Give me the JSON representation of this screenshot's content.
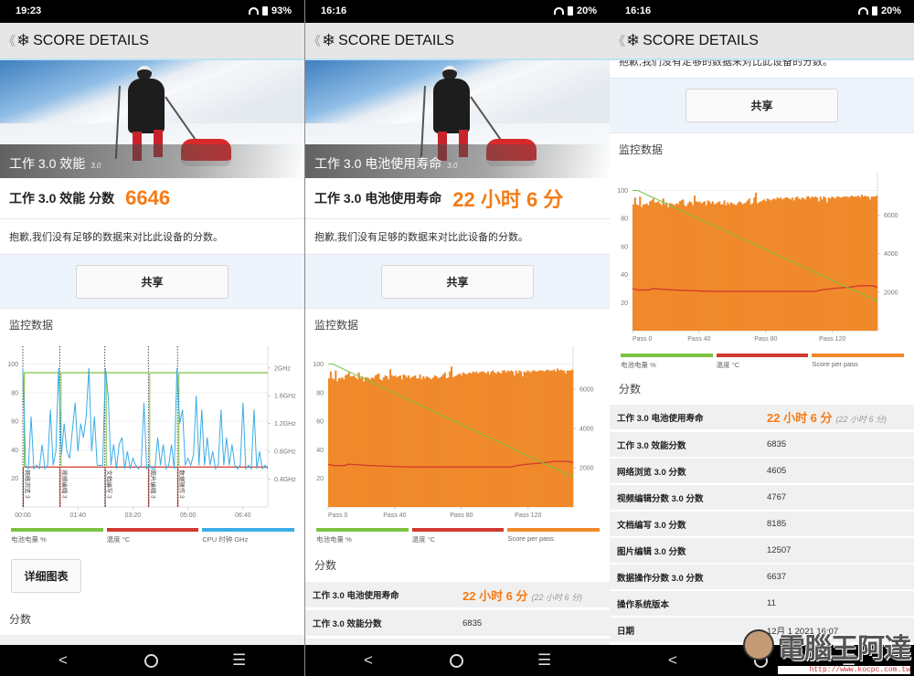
{
  "common": {
    "header_title": "SCORE DETAILS",
    "back_icon": "chevron-left-icon",
    "app_icon": "snowflake-icon",
    "note": "抱歉,我们没有足够的数据来对比此设备的分数。",
    "share": "共享",
    "monitor_title": "监控数据",
    "scores_title": "分数",
    "colors": {
      "accent": "#f47b16",
      "battery": "#7cc242",
      "temperature": "#d0392e",
      "cpu": "#3aade6",
      "score_bar": "#f0892a"
    }
  },
  "screens": [
    {
      "status": {
        "time": "19:23",
        "battery": "93%"
      },
      "hero": {
        "title": "工作 3.0 效能",
        "version": "3.0"
      },
      "score": {
        "label": "工作 3.0 效能 分数",
        "value": "6646"
      },
      "legend": [
        "电池电量 %",
        "温度 °C",
        "CPU 时钟 GHz"
      ],
      "detail_button": "详细图表"
    },
    {
      "status": {
        "time": "16:16",
        "battery": "20%"
      },
      "hero": {
        "title": "工作 3.0 电池使用寿命",
        "version": "3.0"
      },
      "score": {
        "label": "工作 3.0 电池使用寿命",
        "value": "22 小时 6 分"
      },
      "legend": [
        "电池电量 %",
        "温度 °C",
        "Score per pass"
      ],
      "rows": [
        {
          "label": "工作 3.0 电池使用寿命",
          "value": "22 小时 6 分",
          "sub": "(22 小时 6 分)"
        },
        {
          "label": "工作 3.0 效能分数",
          "value": "6835"
        }
      ]
    },
    {
      "status": {
        "time": "16:16",
        "battery": "20%"
      },
      "legend": [
        "电池电量 %",
        "温度 °C",
        "Score per pass"
      ],
      "rows": [
        {
          "label": "工作 3.0 电池使用寿命",
          "value": "22 小时 6 分",
          "sub": "(22 小时 6 分)"
        },
        {
          "label": "工作 3.0 效能分数",
          "value": "6835"
        },
        {
          "label": "网络浏览 3.0 分数",
          "value": "4605"
        },
        {
          "label": "视频编辑分数 3.0 分数",
          "value": "4767"
        },
        {
          "label": "文档编写 3.0 分数",
          "value": "8185"
        },
        {
          "label": "图片编辑 3.0 分数",
          "value": "12507"
        },
        {
          "label": "数据操作分数 3.0 分数",
          "value": "6637"
        },
        {
          "label": "操作系统版本",
          "value": "11"
        },
        {
          "label": "日期",
          "value": "12月 1 2021 16:07"
        }
      ],
      "watermark": {
        "text": "電腦王阿達",
        "url": "http://www.kocpc.com.tw"
      }
    }
  ],
  "chart_data": [
    {
      "type": "line",
      "x_unit": "seconds",
      "xlim": [
        0,
        445
      ],
      "x_ticks": [
        0,
        100,
        200,
        300,
        400
      ],
      "x_tick_labels": [
        "00:00",
        "01:40",
        "03:20",
        "05:00",
        "06:40"
      ],
      "y_left": {
        "lim": [
          0,
          110
        ],
        "ticks": [
          20,
          40,
          60,
          80,
          100
        ]
      },
      "y_right": {
        "lim": [
          0,
          2.26
        ],
        "ticks": [
          0.4,
          0.8,
          1.2,
          1.6,
          2.0
        ],
        "tick_labels": [
          "0.4GHz",
          "0.8GHz",
          "1.2GHz",
          "1.6GHz",
          "2GHz"
        ]
      },
      "grid": true,
      "segments": [
        {
          "start": 0,
          "label": "网络浏览 3"
        },
        {
          "start": 67,
          "label": "视频编辑 3"
        },
        {
          "start": 149,
          "label": "文档编写 3"
        },
        {
          "start": 228,
          "label": "图片编辑 3"
        },
        {
          "start": 281,
          "label": "数据操作 3"
        }
      ],
      "battery_pct": 94,
      "temperature_c": 28,
      "cpu_ghz_step_seconds": 5,
      "cpu_ghz": [
        2.0,
        0.6,
        0.55,
        1.3,
        0.55,
        0.6,
        0.55,
        0.9,
        0.55,
        0.6,
        1.4,
        0.6,
        0.8,
        2.0,
        0.75,
        1.2,
        0.8,
        0.7,
        1.1,
        1.5,
        0.8,
        1.2,
        1.0,
        1.3,
        2.0,
        0.8,
        1.3,
        0.6,
        0.6,
        0.6,
        2.0,
        1.6,
        0.6,
        0.9,
        0.55,
        0.9,
        1.0,
        0.55,
        0.8,
        0.55,
        0.7,
        0.6,
        0.55,
        0.6,
        1.5,
        0.55,
        0.6,
        0.55,
        0.55,
        1.0,
        0.6,
        0.9,
        0.55,
        0.6,
        0.9,
        0.55,
        2.0,
        1.2,
        1.4,
        0.6,
        0.7,
        0.6,
        0.75,
        1.6,
        0.6,
        1.4,
        0.6,
        1.0,
        0.6,
        0.8,
        0.55,
        0.6,
        1.4,
        0.6,
        1.0,
        0.6,
        0.9,
        0.6,
        0.55,
        0.6,
        1.5,
        0.55,
        0.6,
        0.55,
        1.4,
        0.55,
        0.8,
        0.55,
        0.6,
        0.55
      ]
    },
    {
      "type": "bar",
      "xlim": [
        0,
        147
      ],
      "x_ticks": [
        0,
        40,
        80,
        120
      ],
      "x_tick_labels": [
        "Pass 0",
        "Pass 40",
        "Pass 80",
        "Pass 120"
      ],
      "y_left": {
        "lim": [
          0,
          110
        ],
        "ticks": [
          20,
          40,
          60,
          80,
          100
        ]
      },
      "y_right": {
        "lim": [
          0,
          8000
        ],
        "ticks": [
          2000,
          4000,
          6000
        ],
        "tick_labels": [
          "2000",
          "4000",
          "6000"
        ]
      },
      "grid": true,
      "score_per_pass": [
        6550,
        6900,
        6550,
        6500,
        6950,
        6400,
        6550,
        6550,
        6600,
        6500,
        6700,
        6750,
        6850,
        6650,
        6650,
        6700,
        6600,
        6500,
        6850,
        6550,
        6650,
        6400,
        6600,
        6600,
        6550,
        6500,
        6600,
        6550,
        6700,
        6750,
        6800,
        6500,
        6450,
        6600,
        6700,
        6650,
        6500,
        7000,
        6700,
        6650,
        6700,
        6600,
        6650,
        6700,
        6500,
        6750,
        6700,
        6600,
        6700,
        6550,
        6600,
        6650,
        6700,
        6550,
        6550,
        6750,
        6500,
        6650,
        6550,
        6650,
        6600,
        6550,
        6500,
        6600,
        6700,
        6650,
        6550,
        6600,
        6650,
        6750,
        6850,
        6550,
        6600,
        6900,
        7150,
        6600,
        6650,
        6700,
        6750,
        6800,
        6700,
        6850,
        6800,
        6750,
        6800,
        6850,
        6800,
        6900,
        6850,
        6900,
        6800,
        6850,
        6900,
        6900,
        6850,
        6800,
        6900,
        6750,
        6900,
        6950,
        6850,
        6800,
        6900,
        6850,
        6800,
        6950,
        6950,
        6850,
        6950,
        6900,
        6950,
        6900,
        6700,
        6950,
        6800,
        6950,
        6900,
        6650,
        6900,
        6850,
        6950,
        6900,
        6850,
        6950,
        6950,
        6900,
        6900,
        6950,
        6950,
        6950,
        6900,
        6950,
        7000,
        6950,
        6950,
        6950,
        7000,
        6900,
        7050,
        6950,
        7000,
        6950,
        6950,
        6800,
        6950,
        6950,
        6950,
        7000
      ],
      "battery_pct": [
        [
          0,
          100
        ],
        [
          3,
          100
        ],
        [
          147,
          21
        ]
      ],
      "temperature_c": [
        [
          0,
          30
        ],
        [
          3,
          29
        ],
        [
          10,
          29
        ],
        [
          12,
          30
        ],
        [
          25,
          29
        ],
        [
          48,
          28
        ],
        [
          110,
          28
        ],
        [
          113,
          29
        ],
        [
          120,
          30
        ],
        [
          130,
          31
        ],
        [
          136,
          32
        ],
        [
          144,
          32
        ],
        [
          147,
          31
        ]
      ]
    }
  ]
}
